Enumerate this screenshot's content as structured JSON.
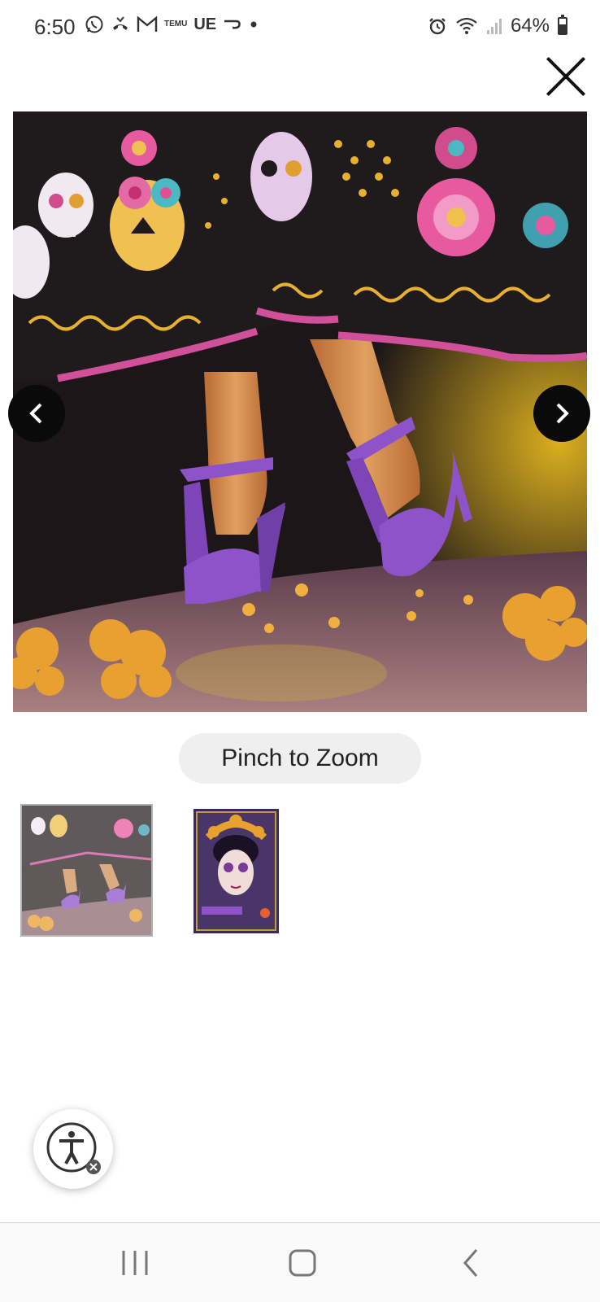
{
  "status_bar": {
    "time": "6:50",
    "left_icons": [
      "whatsapp-icon",
      "missed-call-icon",
      "gmail-icon",
      "temu-icon",
      "ue-text",
      "swipe-icon",
      "dot-icon"
    ],
    "ue_text": "UE",
    "temu_text": "TEMU",
    "battery": "64%"
  },
  "viewer": {
    "close_icon": "close-icon",
    "prev_icon": "chevron-left-icon",
    "next_icon": "chevron-right-icon",
    "pinch_label": "Pinch to Zoom",
    "thumbnails": [
      {
        "name": "doll-shoes-thumbnail",
        "selected": true
      },
      {
        "name": "doll-box-thumbnail",
        "selected": false
      }
    ]
  },
  "accessibility": {
    "icon": "accessibility-icon"
  },
  "nav_bar": {
    "recent_icon": "recent-apps-icon",
    "home_icon": "home-icon",
    "back_icon": "back-icon"
  },
  "colors": {
    "dress_black": "#1f1a1c",
    "hem_pink": "#d0509a",
    "shoe_purple": "#8e52c9",
    "marigold": "#e8a030"
  }
}
